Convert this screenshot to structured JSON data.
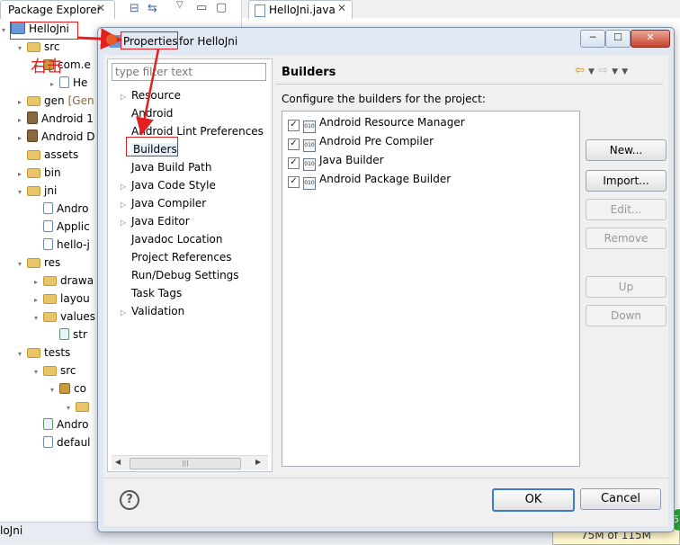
{
  "explorer": {
    "tab_label": "Package Explorer",
    "tree": [
      {
        "label": "HelloJni",
        "icon": "project-icon",
        "twisty": "▾"
      },
      {
        "label": "src",
        "icon": "folder-icon",
        "twisty": "▾"
      },
      {
        "label": "com.e",
        "icon": "package-icon",
        "twisty": "▾"
      },
      {
        "label": "He",
        "icon": "java-file-icon",
        "twisty": "▸"
      },
      {
        "label": "gen",
        "label2": "[Gen",
        "icon": "folder-icon",
        "twisty": "▸"
      },
      {
        "label": "Android 1",
        "icon": "jar-icon",
        "twisty": "▸"
      },
      {
        "label": "Android D",
        "icon": "jar-icon",
        "twisty": "▸"
      },
      {
        "label": "assets",
        "icon": "folder-icon",
        "twisty": ""
      },
      {
        "label": "bin",
        "icon": "folder-icon",
        "twisty": "▸"
      },
      {
        "label": "jni",
        "icon": "folder-icon",
        "twisty": "▾"
      },
      {
        "label": "Andro",
        "icon": "file-icon",
        "twisty": ""
      },
      {
        "label": "Applic",
        "icon": "file-icon",
        "twisty": ""
      },
      {
        "label": "hello-j",
        "icon": "c-file-icon",
        "twisty": ""
      },
      {
        "label": "res",
        "icon": "folder-icon",
        "twisty": "▾"
      },
      {
        "label": "drawa",
        "icon": "folder-icon",
        "twisty": "▸"
      },
      {
        "label": "layou",
        "icon": "folder-icon",
        "twisty": "▸"
      },
      {
        "label": "values",
        "icon": "folder-icon",
        "twisty": "▾"
      },
      {
        "label": "str",
        "icon": "xml-file-icon",
        "twisty": ""
      },
      {
        "label": "tests",
        "icon": "folder-icon",
        "twisty": "▾"
      },
      {
        "label": "src",
        "icon": "folder-icon",
        "twisty": "▾"
      },
      {
        "label": "co",
        "icon": "package-icon",
        "twisty": "▾"
      },
      {
        "label": "",
        "icon": "folder-icon",
        "twisty": "▾"
      },
      {
        "label": "Andro",
        "icon": "xml-file-icon",
        "twisty": ""
      },
      {
        "label": "defaul",
        "icon": "file-icon",
        "twisty": ""
      }
    ]
  },
  "editor": {
    "tab_label": "HelloJni.java"
  },
  "annotation": {
    "right_click_text": "右击"
  },
  "status": {
    "left": "loJni",
    "memory": "75M of 115M",
    "badge": "5"
  },
  "dialog": {
    "title_prefix": "Properties",
    "title_suffix": "for HelloJni",
    "window_buttons": {
      "minimize": "─",
      "maximize": "☐",
      "close": "✕"
    },
    "filter_placeholder": "type filter text",
    "nav": [
      {
        "label": "Resource",
        "twisty": "▷"
      },
      {
        "label": "Android",
        "twisty": ""
      },
      {
        "label": "Android Lint Preferences",
        "twisty": ""
      },
      {
        "label": "Builders",
        "twisty": "",
        "selected": true
      },
      {
        "label": "Java Build Path",
        "twisty": ""
      },
      {
        "label": "Java Code Style",
        "twisty": "▷"
      },
      {
        "label": "Java Compiler",
        "twisty": "▷"
      },
      {
        "label": "Java Editor",
        "twisty": "▷"
      },
      {
        "label": "Javadoc Location",
        "twisty": ""
      },
      {
        "label": "Project References",
        "twisty": ""
      },
      {
        "label": "Run/Debug Settings",
        "twisty": ""
      },
      {
        "label": "Task Tags",
        "twisty": ""
      },
      {
        "label": "Validation",
        "twisty": "▷"
      }
    ],
    "page_title": "Builders",
    "page_description": "Configure the builders for the project:",
    "builders": [
      {
        "label": "Android Resource Manager",
        "checked": true,
        "icon_text": "010"
      },
      {
        "label": "Android Pre Compiler",
        "checked": true,
        "icon_text": "010"
      },
      {
        "label": "Java Builder",
        "checked": true,
        "icon_text": "010"
      },
      {
        "label": "Android Package Builder",
        "checked": true,
        "icon_text": "010"
      }
    ],
    "buttons": {
      "new": "New...",
      "import": "Import...",
      "edit": "Edit...",
      "remove": "Remove",
      "up": "Up",
      "down": "Down",
      "ok": "OK",
      "cancel": "Cancel"
    },
    "help_glyph": "?"
  },
  "colors": {
    "annotation_red": "#e32020",
    "dialog_frame": "#dfe8f3",
    "ok_focus": "#3d7bc8"
  }
}
